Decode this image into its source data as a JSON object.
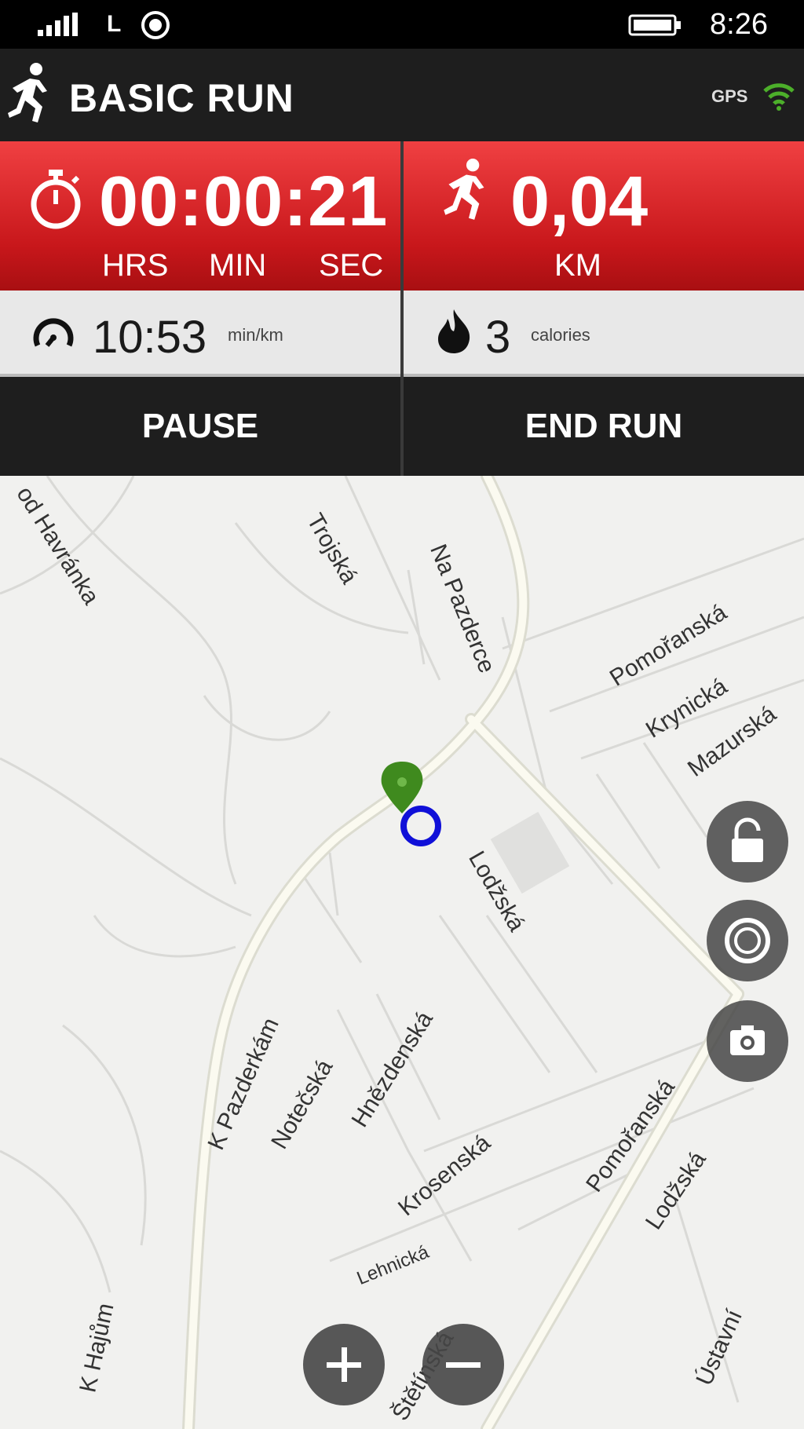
{
  "status_bar": {
    "network": "L",
    "time": "8:26"
  },
  "header": {
    "title": "BASIC RUN",
    "gps_label": "GPS"
  },
  "timer": {
    "value": "00:00:21",
    "units": [
      "HRS",
      "MIN",
      "SEC"
    ]
  },
  "distance": {
    "value": "0,04",
    "unit": "KM"
  },
  "pace": {
    "value": "10:53",
    "unit": "min/km"
  },
  "calories": {
    "value": "3",
    "unit": "calories"
  },
  "actions": {
    "pause": "PAUSE",
    "end_run": "END RUN"
  },
  "map": {
    "streets": [
      "od Havránka",
      "Trojská",
      "Na Pazderce",
      "Pomořanská",
      "Krynická",
      "Mazurská",
      "Lodžská",
      "K Pazderkám",
      "Notečská",
      "Hnězdenská",
      "Pomořanská",
      "Lodžská",
      "Krosenská",
      "Lehnická",
      "K Hajům",
      "Štětínská",
      "Ústavní"
    ]
  },
  "colors": {
    "accent_red": "#d8262a",
    "marker_green": "#3f8a1e",
    "position_blue": "#1010d8",
    "gps_green": "#4caf2a"
  }
}
